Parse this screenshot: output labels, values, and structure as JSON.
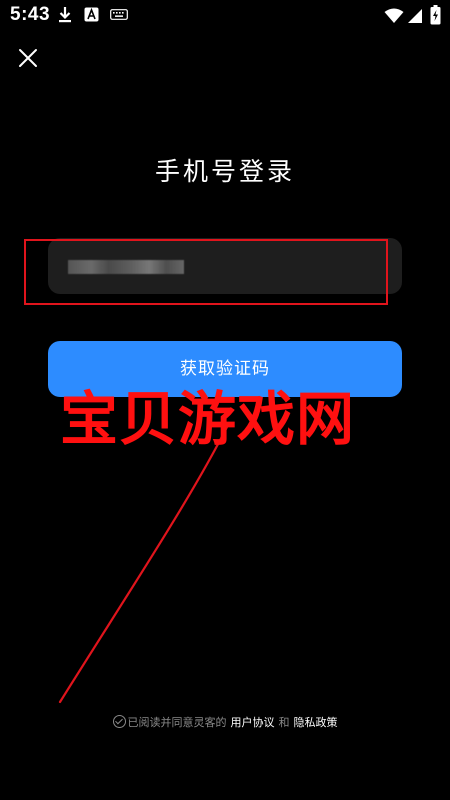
{
  "status_bar": {
    "time": "5:43",
    "left_icons": [
      "download-icon",
      "a-notification-icon",
      "keyboard-icon"
    ],
    "right_icons": [
      "wifi-icon",
      "signal-icon",
      "battery-charging-icon"
    ]
  },
  "header": {
    "close_icon": "close-icon"
  },
  "login": {
    "title": "手机号登录",
    "phone_value_obscured": true,
    "get_code_label": "获取验证码",
    "button_color": "#2d8cff"
  },
  "watermark": {
    "text": "宝贝游戏网",
    "color": "#ff1010"
  },
  "agreement": {
    "prefix": "已阅读并同意灵客的",
    "user_agreement": "用户协议",
    "and": "和",
    "privacy_policy": "隐私政策"
  }
}
